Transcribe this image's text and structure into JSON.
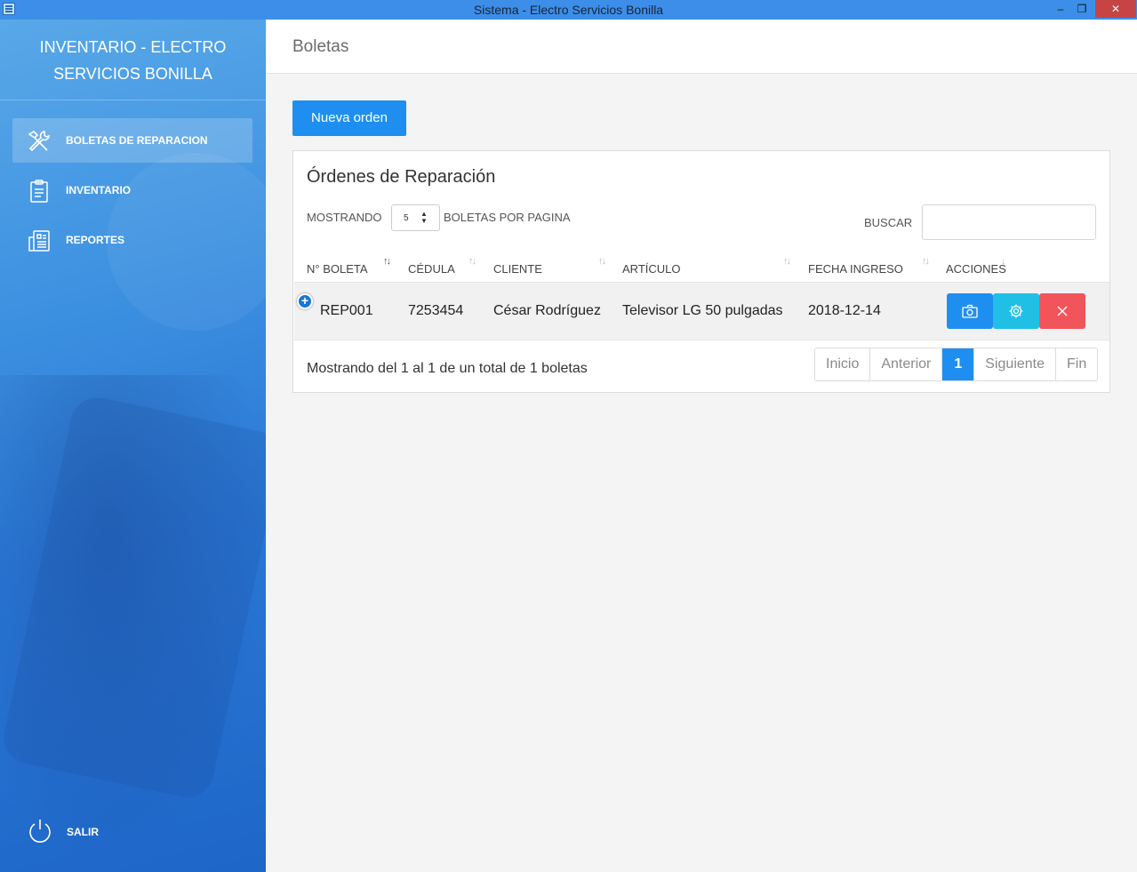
{
  "window": {
    "title": "Sistema - Electro Servicios Bonilla",
    "minimize": "‒",
    "maximize": "❐",
    "close": "✕"
  },
  "sidebar": {
    "brand_line1": "INVENTARIO - ELECTRO",
    "brand_line2": "SERVICIOS BONILLA",
    "items": [
      {
        "label": "BOLETAS DE REPARACION",
        "icon": "tools-icon",
        "active": true
      },
      {
        "label": "INVENTARIO",
        "icon": "clipboard-icon",
        "active": false
      },
      {
        "label": "REPORTES",
        "icon": "report-icon",
        "active": false
      }
    ],
    "logout": {
      "label": "SALIR",
      "icon": "power-icon"
    }
  },
  "header": {
    "title": "Boletas"
  },
  "toolbar": {
    "new_order": "Nueva orden"
  },
  "table_card": {
    "title": "Órdenes de Reparación",
    "length_prefix": "MOSTRANDO",
    "length_value": "5",
    "length_suffix": "BOLETAS POR PAGINA",
    "search_label": "BUSCAR",
    "search_value": "",
    "columns": [
      "N° BOLETA",
      "CÉDULA",
      "CLIENTE",
      "ARTÍCULO",
      "FECHA INGRESO",
      "ACCIONES"
    ],
    "rows": [
      {
        "boleta": "REP001",
        "cedula": "7253454",
        "cliente": "César Rodríguez",
        "articulo": "Televisor LG 50 pulgadas",
        "fecha": "2018-12-14"
      }
    ],
    "info": "Mostrando del 1 al 1 de un total de 1 boletas",
    "pagination": {
      "first": "Inicio",
      "prev": "Anterior",
      "current": "1",
      "next": "Siguiente",
      "last": "Fin"
    }
  },
  "colors": {
    "accent": "#1e8ff0",
    "info": "#20c0e6",
    "danger": "#f2545b",
    "sidebar": "#2a78d6"
  }
}
